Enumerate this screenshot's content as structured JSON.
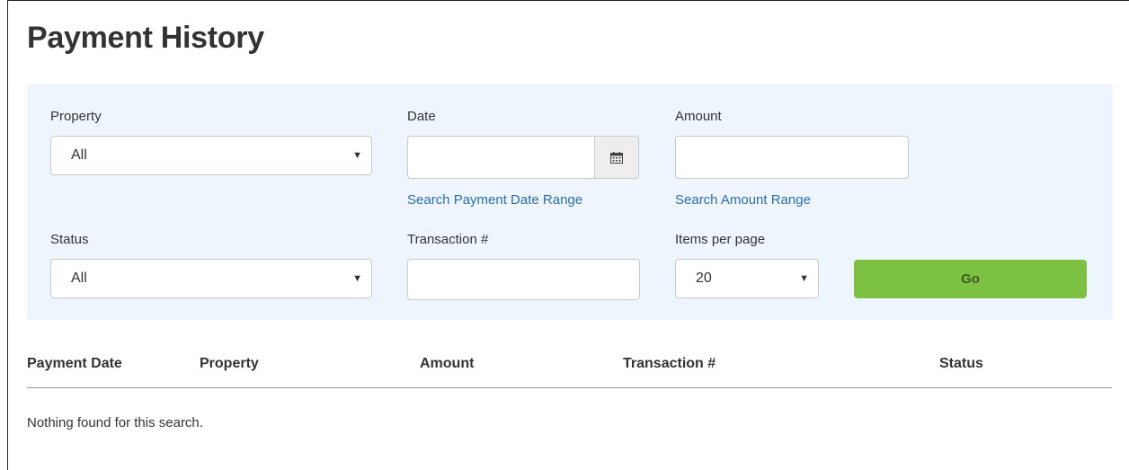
{
  "page": {
    "title": "Payment History"
  },
  "filters": {
    "property": {
      "label": "Property",
      "value": "All"
    },
    "date": {
      "label": "Date",
      "value": "",
      "range_link": "Search Payment Date Range"
    },
    "amount": {
      "label": "Amount",
      "value": "",
      "range_link": "Search Amount Range"
    },
    "status": {
      "label": "Status",
      "value": "All"
    },
    "transaction": {
      "label": "Transaction #",
      "value": ""
    },
    "items_per_page": {
      "label": "Items per page",
      "value": "20"
    },
    "go_label": "Go"
  },
  "table": {
    "columns": [
      "Payment Date",
      "Property",
      "Amount",
      "Transaction #",
      "Status"
    ],
    "rows": [],
    "empty_message": "Nothing found for this search."
  },
  "colors": {
    "panel_bg": "#eef5fd",
    "link": "#2a6ead",
    "go_button": "#7dc142"
  },
  "icons": {
    "calendar": "calendar-icon",
    "dropdown": "caret-down-icon"
  }
}
